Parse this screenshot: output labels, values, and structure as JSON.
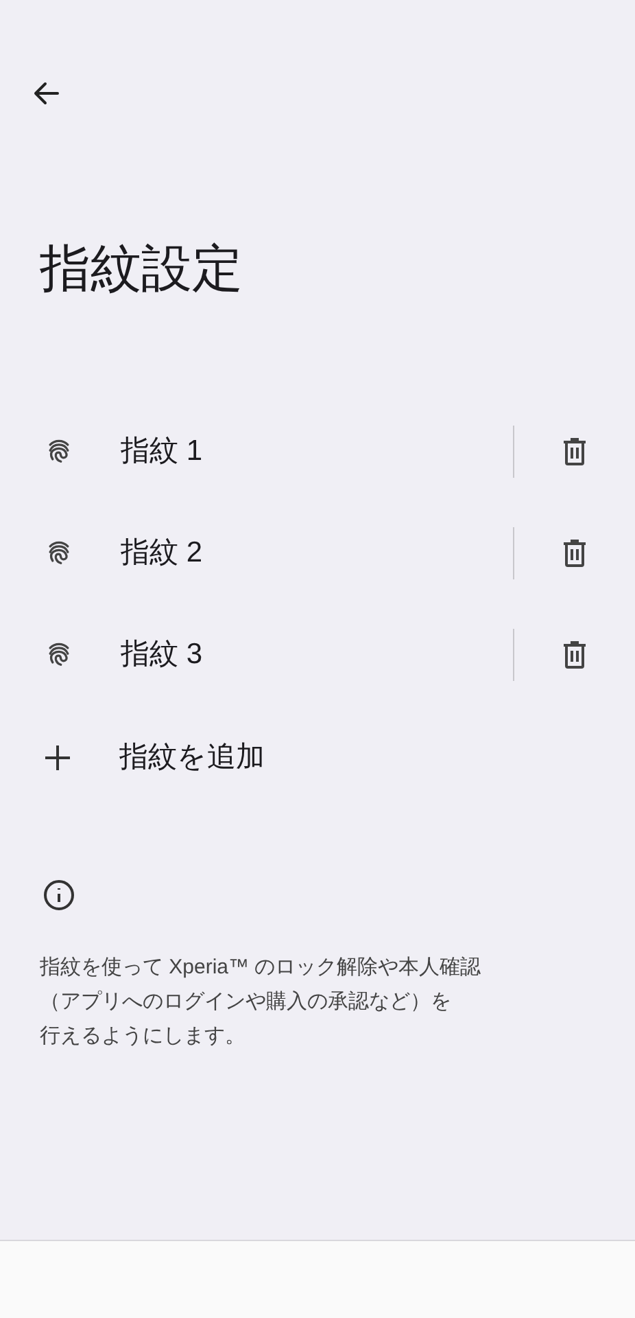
{
  "title": "指紋設定",
  "fingerprints": [
    {
      "label": "指紋 1"
    },
    {
      "label": "指紋 2"
    },
    {
      "label": "指紋 3"
    }
  ],
  "add_item": {
    "label": "指紋を追加"
  },
  "info": {
    "lines": [
      "指紋を使って Xperia™ のロック解除や本人確認",
      "（アプリへのログインや購入の承認など）を",
      "行えるようにします。"
    ]
  }
}
